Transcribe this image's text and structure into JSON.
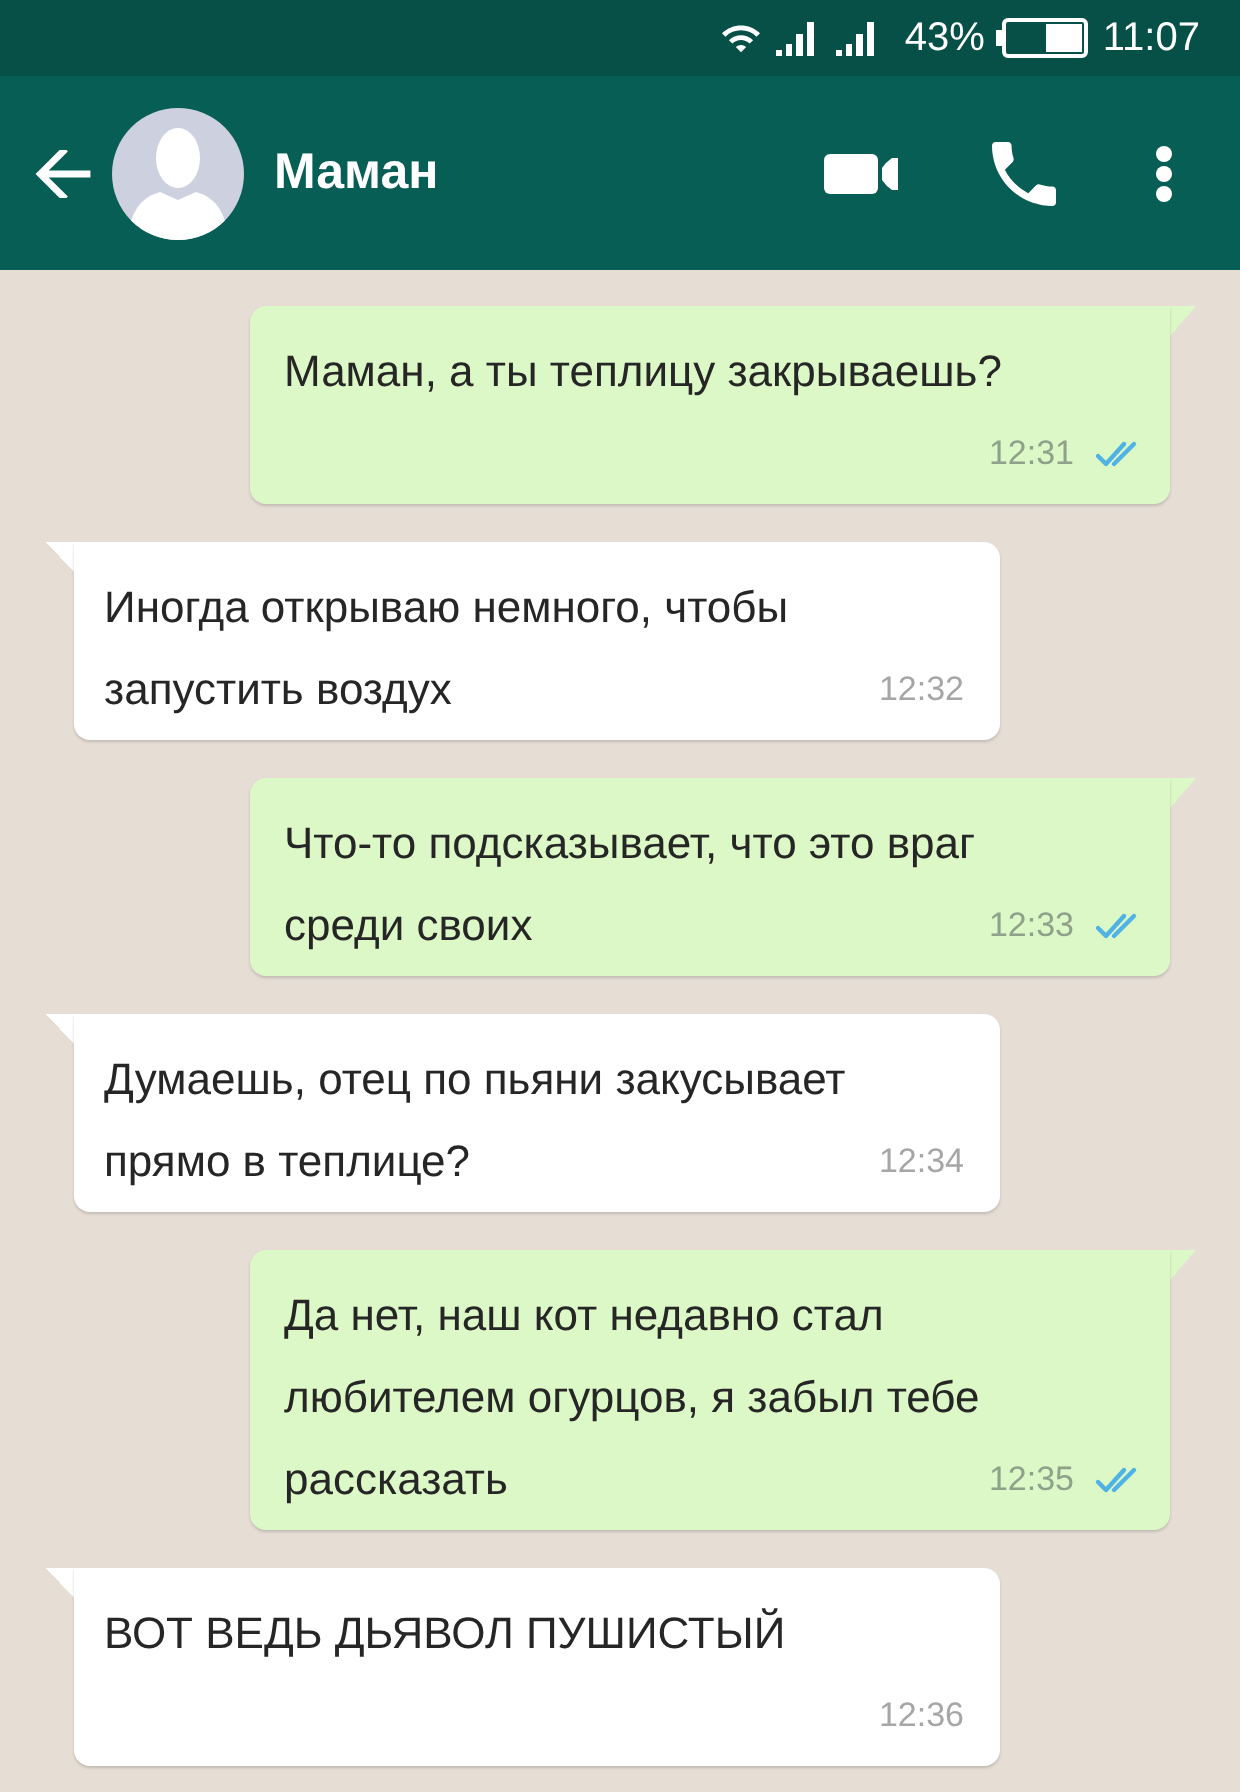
{
  "status_bar": {
    "battery_percent": "43%",
    "time": "11:07"
  },
  "header": {
    "contact_name": "Маман"
  },
  "messages": [
    {
      "kind": "outgoing",
      "text": "Маман, а ты теплицу закрываешь?",
      "time": "12:31",
      "read": true
    },
    {
      "kind": "incoming",
      "text": "Иногда открываю немного, чтобы запустить воздух",
      "time": "12:32"
    },
    {
      "kind": "outgoing",
      "text": "Что-то подсказывает, что это враг среди своих",
      "time": "12:33",
      "read": true
    },
    {
      "kind": "incoming",
      "text": "Думаешь, отец по пьяни закусывает прямо в теплице?",
      "time": "12:34"
    },
    {
      "kind": "outgoing",
      "text": "Да нет, наш кот недавно стал любителем огурцов, я забыл тебе рассказать",
      "time": "12:35",
      "read": true
    },
    {
      "kind": "incoming",
      "text": "ВОТ ВЕДЬ ДЬЯВОЛ ПУШИСТЫЙ",
      "time": "12:36"
    }
  ]
}
